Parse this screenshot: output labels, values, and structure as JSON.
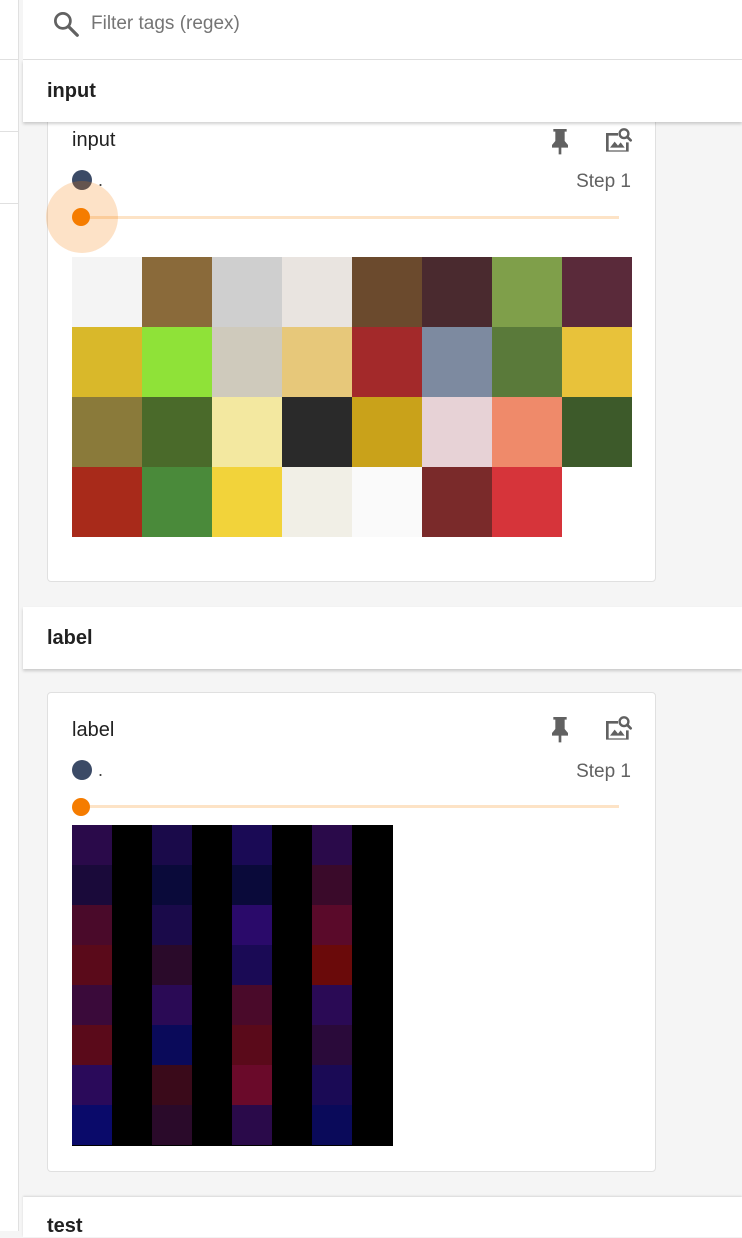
{
  "filter": {
    "placeholder": "Filter tags (regex)"
  },
  "groups": [
    {
      "header": "input",
      "card": {
        "title": "input",
        "run_label": ".",
        "step_label": "Step 1",
        "step_fraction": 0,
        "tile_colors": [
          [
            "#f4f4f4",
            "#8a6a3a",
            "#cfcfcf",
            "#e9e4e0",
            "#6b4a2d",
            "#4a2a2f",
            "#7f9f4a",
            "#5a2a3a"
          ],
          [
            "#d9b82a",
            "#8fe238",
            "#cfcabc",
            "#e7c87a",
            "#a3292a",
            "#7d8aa0",
            "#5a7a3a",
            "#e8c23a"
          ],
          [
            "#8a7a3a",
            "#4a6a2a",
            "#f3e8a0",
            "#2a2a2a",
            "#c9a21a",
            "#e7d2d6",
            "#ef8a6a",
            "#3d5a2a"
          ],
          [
            "#a82a1a",
            "#4a8a3a",
            "#f2d33a",
            "#f1efe6",
            "#fafafa",
            "#7a2a2a",
            "#d6343a",
            "#ffffff"
          ]
        ]
      }
    },
    {
      "header": "label",
      "card": {
        "title": "label",
        "run_label": ".",
        "step_label": "Step 1",
        "step_fraction": 0,
        "tile_colors": [
          [
            "#2a0a4a",
            "#000000",
            "#1a0a4a",
            "#000000",
            "#1a0a55",
            "#000000",
            "#2a0a4a",
            "#000000"
          ],
          [
            "#1a0a3a",
            "#000000",
            "#0a0a3a",
            "#000000",
            "#0a0a3a",
            "#000000",
            "#3a0a2a",
            "#000000"
          ],
          [
            "#4a0a2a",
            "#000000",
            "#1a0a4a",
            "#000000",
            "#2a0a6a",
            "#000000",
            "#5a0a2a",
            "#000000"
          ],
          [
            "#5a0a1a",
            "#000000",
            "#2a0a2a",
            "#000000",
            "#1a0a55",
            "#000000",
            "#6a0a0a",
            "#000000"
          ],
          [
            "#3a0a3a",
            "#000000",
            "#2a0a55",
            "#000000",
            "#4a0a2a",
            "#000000",
            "#2a0a55",
            "#000000"
          ],
          [
            "#5a0a1a",
            "#000000",
            "#0a0a5a",
            "#000000",
            "#5a0a1a",
            "#000000",
            "#2a0a3a",
            "#000000"
          ],
          [
            "#2a0a5a",
            "#000000",
            "#3a0a1a",
            "#000000",
            "#6a0a2a",
            "#000000",
            "#1a0a55",
            "#000000"
          ],
          [
            "#0a0a6a",
            "#000000",
            "#2a0a2a",
            "#000000",
            "#2a0a4a",
            "#000000",
            "#0a0a5a",
            "#000000"
          ]
        ]
      }
    },
    {
      "header": "test"
    }
  ]
}
